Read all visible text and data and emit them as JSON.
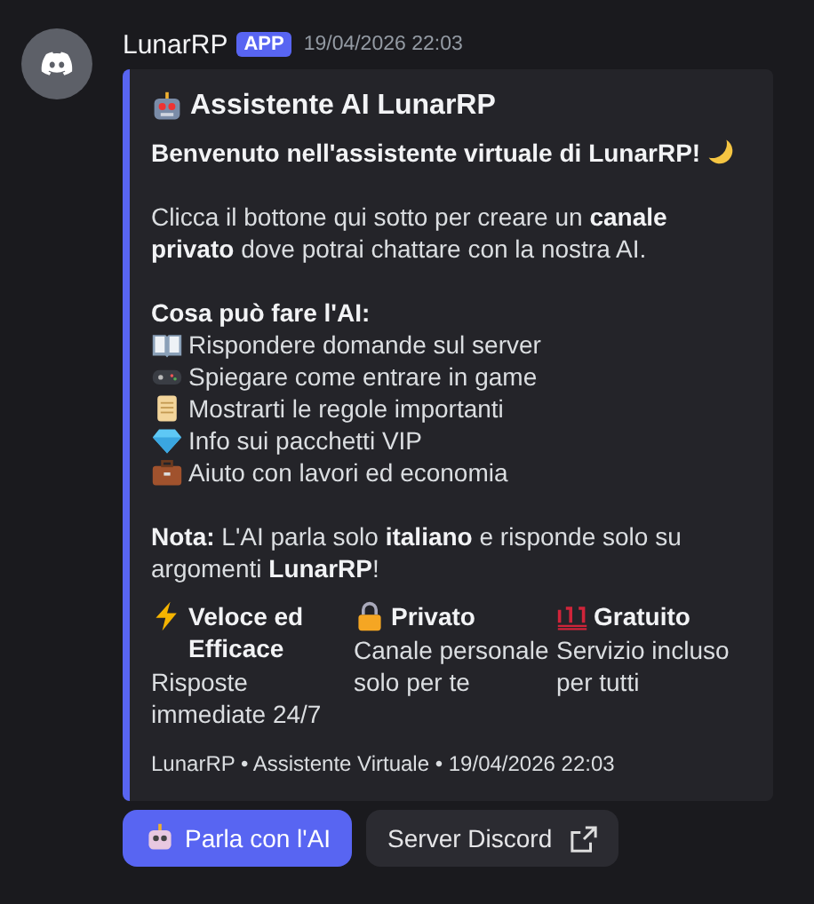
{
  "message": {
    "author": "LunarRP",
    "badge": "APP",
    "timestamp": "19/04/2026 22:03"
  },
  "embed": {
    "title": "Assistente AI LunarRP",
    "welcome": "Benvenuto nell'assistente virtuale di LunarRP!",
    "intro": "Clicca il bottone qui sotto per creare un **canale privato** dove potrai chattare con la nostra AI.",
    "features_heading": "Cosa può fare l'AI:",
    "features": [
      "Rispondere domande sul server",
      "Spiegare come entrare in game",
      "Mostrarti le regole importanti",
      "Info sui pacchetti VIP",
      "Aiuto con lavori ed economia"
    ],
    "note": "**Nota:** L'AI parla solo **italiano** e risponde solo su argomenti **LunarRP**!",
    "fields": [
      {
        "name": "Veloce ed Efficace",
        "value": "Risposte immediate 24/7"
      },
      {
        "name": "Privato",
        "value": "Canale personale solo per te"
      },
      {
        "name": "Gratuito",
        "value": "Servizio incluso per tutti"
      }
    ],
    "footer": "LunarRP • Assistente Virtuale • 19/04/2026 22:03"
  },
  "buttons": [
    {
      "label": "Parla con l'AI",
      "kind": "primary"
    },
    {
      "label": "Server Discord",
      "kind": "link"
    }
  ]
}
